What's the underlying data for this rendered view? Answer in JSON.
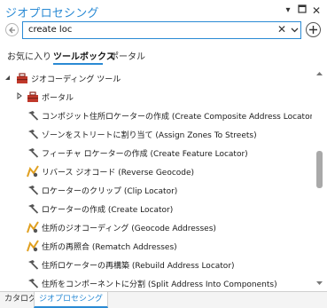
{
  "title": "ジオプロセシング",
  "search": {
    "value": "create loc"
  },
  "tabs": [
    {
      "label": "お気に入り",
      "active": false
    },
    {
      "label": "ツールボックス",
      "active": true
    },
    {
      "label": "ポータル",
      "active": false
    }
  ],
  "tree": {
    "toolbox": {
      "label": "ジオコーディング ツール",
      "expanded": true
    },
    "folder": {
      "label": "ポータル",
      "expanded": false
    },
    "tools": [
      {
        "label": "コンポジット住所ロケーターの作成 (Create Composite Address Locator)",
        "icon": "hammer-icon"
      },
      {
        "label": "ゾーンをストリートに割り当て (Assign Zones To Streets)",
        "icon": "hammer-icon"
      },
      {
        "label": "フィーチャ ロケーターの作成 (Create Feature Locator)",
        "icon": "hammer-icon"
      },
      {
        "label": "リバース ジオコード (Reverse Geocode)",
        "icon": "geocode-icon"
      },
      {
        "label": "ロケーターのクリップ (Clip Locator)",
        "icon": "hammer-icon"
      },
      {
        "label": "ロケーターの作成 (Create Locator)",
        "icon": "hammer-icon"
      },
      {
        "label": "住所のジオコーディング (Geocode Addresses)",
        "icon": "geocode-icon"
      },
      {
        "label": "住所の再照合 (Rematch Addresses)",
        "icon": "geocode-icon"
      },
      {
        "label": "住所ロケーターの再構築 (Rebuild Address Locator)",
        "icon": "hammer-icon"
      },
      {
        "label": "住所をコンポーネントに分割 (Split Address Into Components)",
        "icon": "hammer-icon"
      }
    ]
  },
  "bottom_tabs": [
    {
      "label": "カタログ",
      "active": false
    },
    {
      "label": "ジオプロセシング",
      "active": true
    }
  ],
  "colors": {
    "accent": "#2a8ad4",
    "toolbox": "#c0392b",
    "geocode": "#e0a020"
  }
}
